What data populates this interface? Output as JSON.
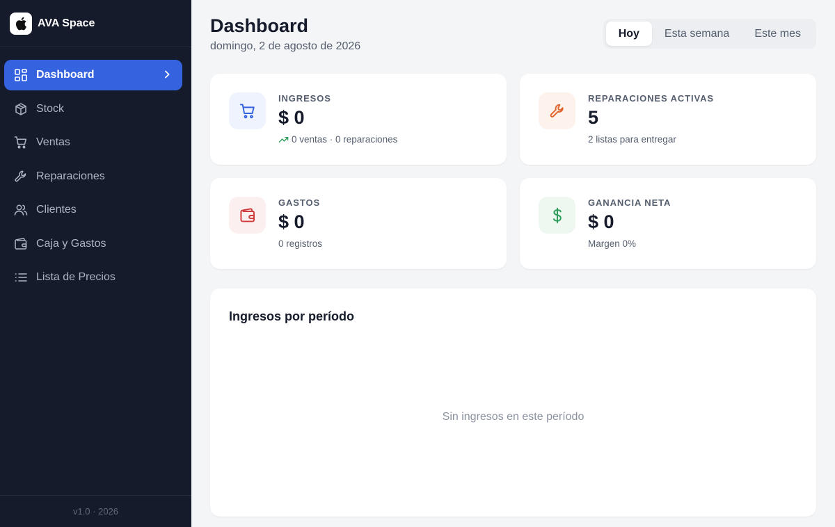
{
  "brand": {
    "name": "AVA Space"
  },
  "sidebar": {
    "items": [
      {
        "label": "Dashboard",
        "icon": "dashboard-icon",
        "active": true
      },
      {
        "label": "Stock",
        "icon": "box-icon"
      },
      {
        "label": "Ventas",
        "icon": "cart-icon"
      },
      {
        "label": "Reparaciones",
        "icon": "wrench-icon"
      },
      {
        "label": "Clientes",
        "icon": "users-icon"
      },
      {
        "label": "Caja y Gastos",
        "icon": "wallet-icon"
      },
      {
        "label": "Lista de Precios",
        "icon": "list-icon"
      }
    ],
    "footer": "v1.0 · 2026"
  },
  "header": {
    "title": "Dashboard",
    "date": "domingo, 2 de agosto de 2026",
    "periods": [
      "Hoy",
      "Esta semana",
      "Este mes"
    ],
    "selected_period": "Hoy"
  },
  "stats": {
    "ingresos": {
      "label": "INGRESOS",
      "value": "$ 0",
      "sub": "0 ventas · 0 reparaciones",
      "icon": "cart-icon",
      "accent": "#3563e0",
      "bg": "#eef3fd"
    },
    "reparaciones": {
      "label": "REPARACIONES ACTIVAS",
      "value": "5",
      "sub": "2 listas para entregar",
      "icon": "wrench-icon",
      "accent": "#e2642a",
      "bg": "#fdf3ec"
    },
    "gastos": {
      "label": "GASTOS",
      "value": "$ 0",
      "sub": "0 registros",
      "icon": "wallet-icon",
      "accent": "#d03a3a",
      "bg": "#fcefef"
    },
    "ganancia": {
      "label": "GANANCIA NETA",
      "value": "$ 0",
      "sub": "Margen 0%",
      "icon": "dollar-icon",
      "accent": "#2f9e5a",
      "bg": "#eef8f1"
    }
  },
  "panel": {
    "title": "Ingresos por período",
    "empty": "Sin ingresos en este período"
  }
}
